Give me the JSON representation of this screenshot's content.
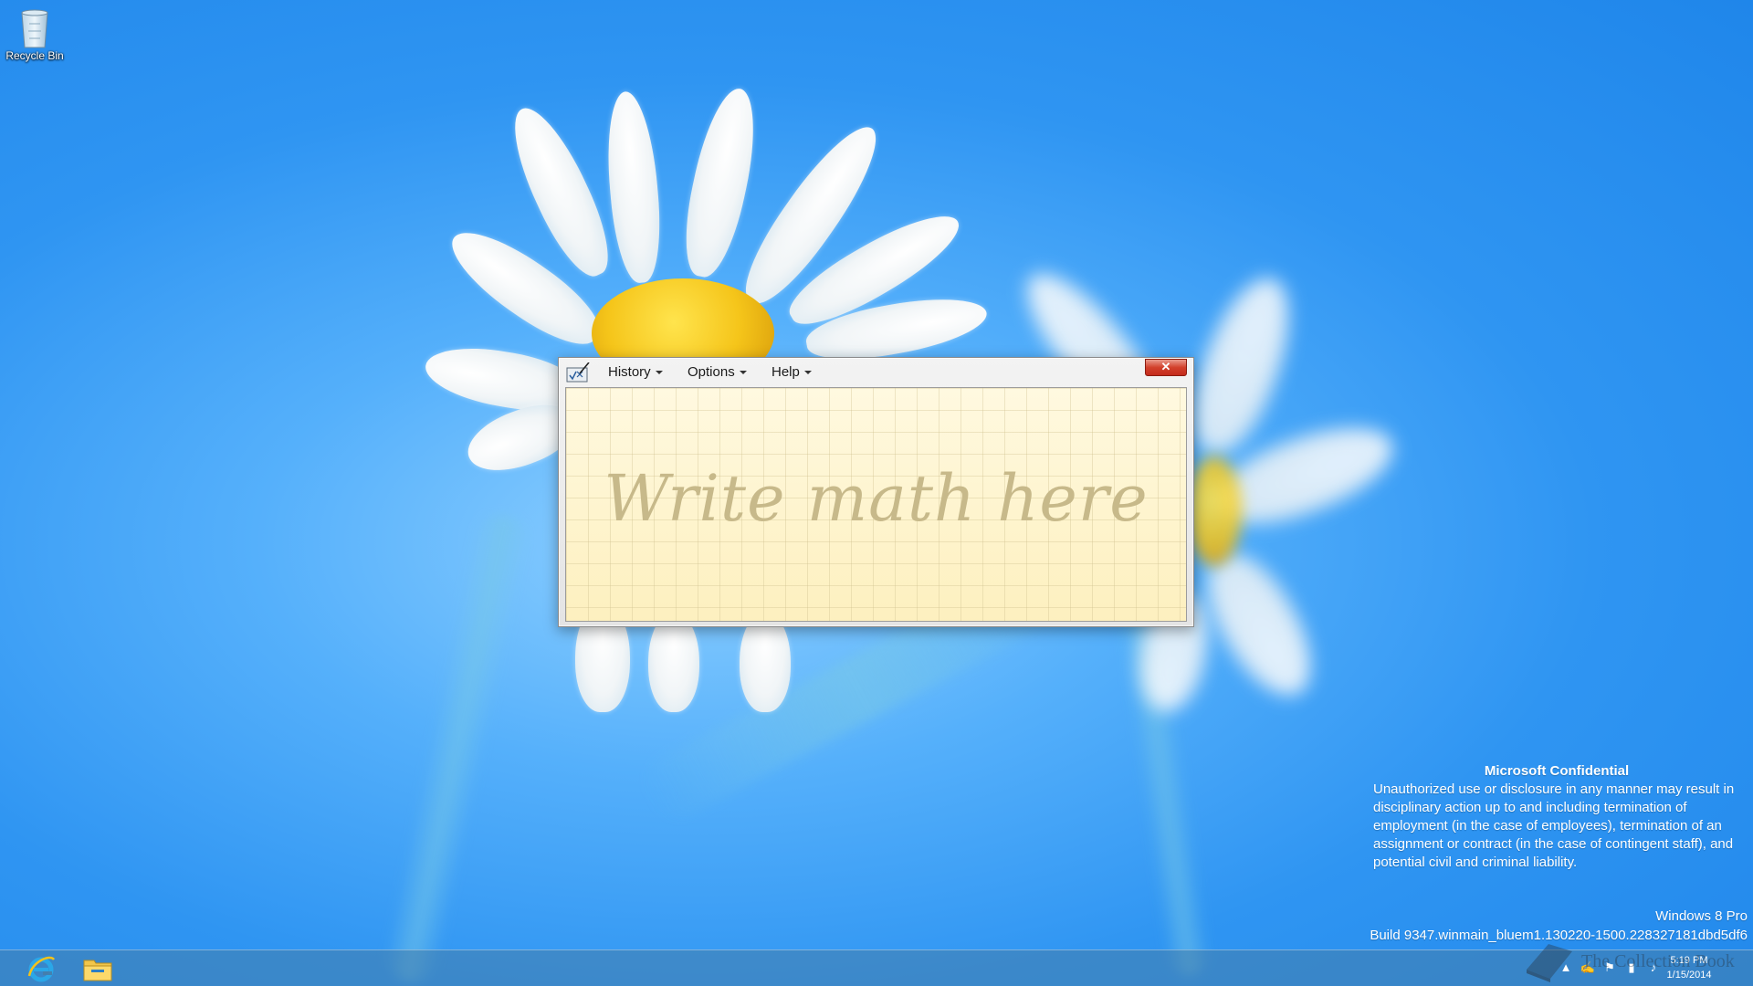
{
  "desktop": {
    "icons": [
      {
        "label": "Recycle Bin",
        "icon": "recycle-bin-icon"
      }
    ]
  },
  "math_input_panel": {
    "menu": {
      "history": "History",
      "options": "Options",
      "help": "Help"
    },
    "close_glyph": "✕",
    "placeholder": "Write math here",
    "colors": {
      "writing_bg": "#fff5cf",
      "placeholder_text": "#c7b98a",
      "close_button": "#c42b1c"
    }
  },
  "confidential": {
    "title": "Microsoft Confidential",
    "body": "Unauthorized use or disclosure in any manner may result in disciplinary action up to and including termination of employment (in the case of employees), termination of an assignment or contract (in the case of contingent staff), and potential civil and criminal liability."
  },
  "edition": {
    "name": "Windows 8 Pro",
    "build": "Build 9347.winmain_bluem1.130220-1500.228327181dbd5df6"
  },
  "taskbar": {
    "pinned": [
      {
        "name": "internet-explorer-icon"
      },
      {
        "name": "file-explorer-icon"
      }
    ],
    "tray_icons": [
      "show-hidden-icons-icon",
      "math-input-tray-icon",
      "action-center-flag-icon",
      "network-icon",
      "volume-icon"
    ],
    "clock": {
      "time": "5:19 PM",
      "date": "1/15/2014"
    }
  },
  "watermark": {
    "text": "The Collection Book"
  }
}
